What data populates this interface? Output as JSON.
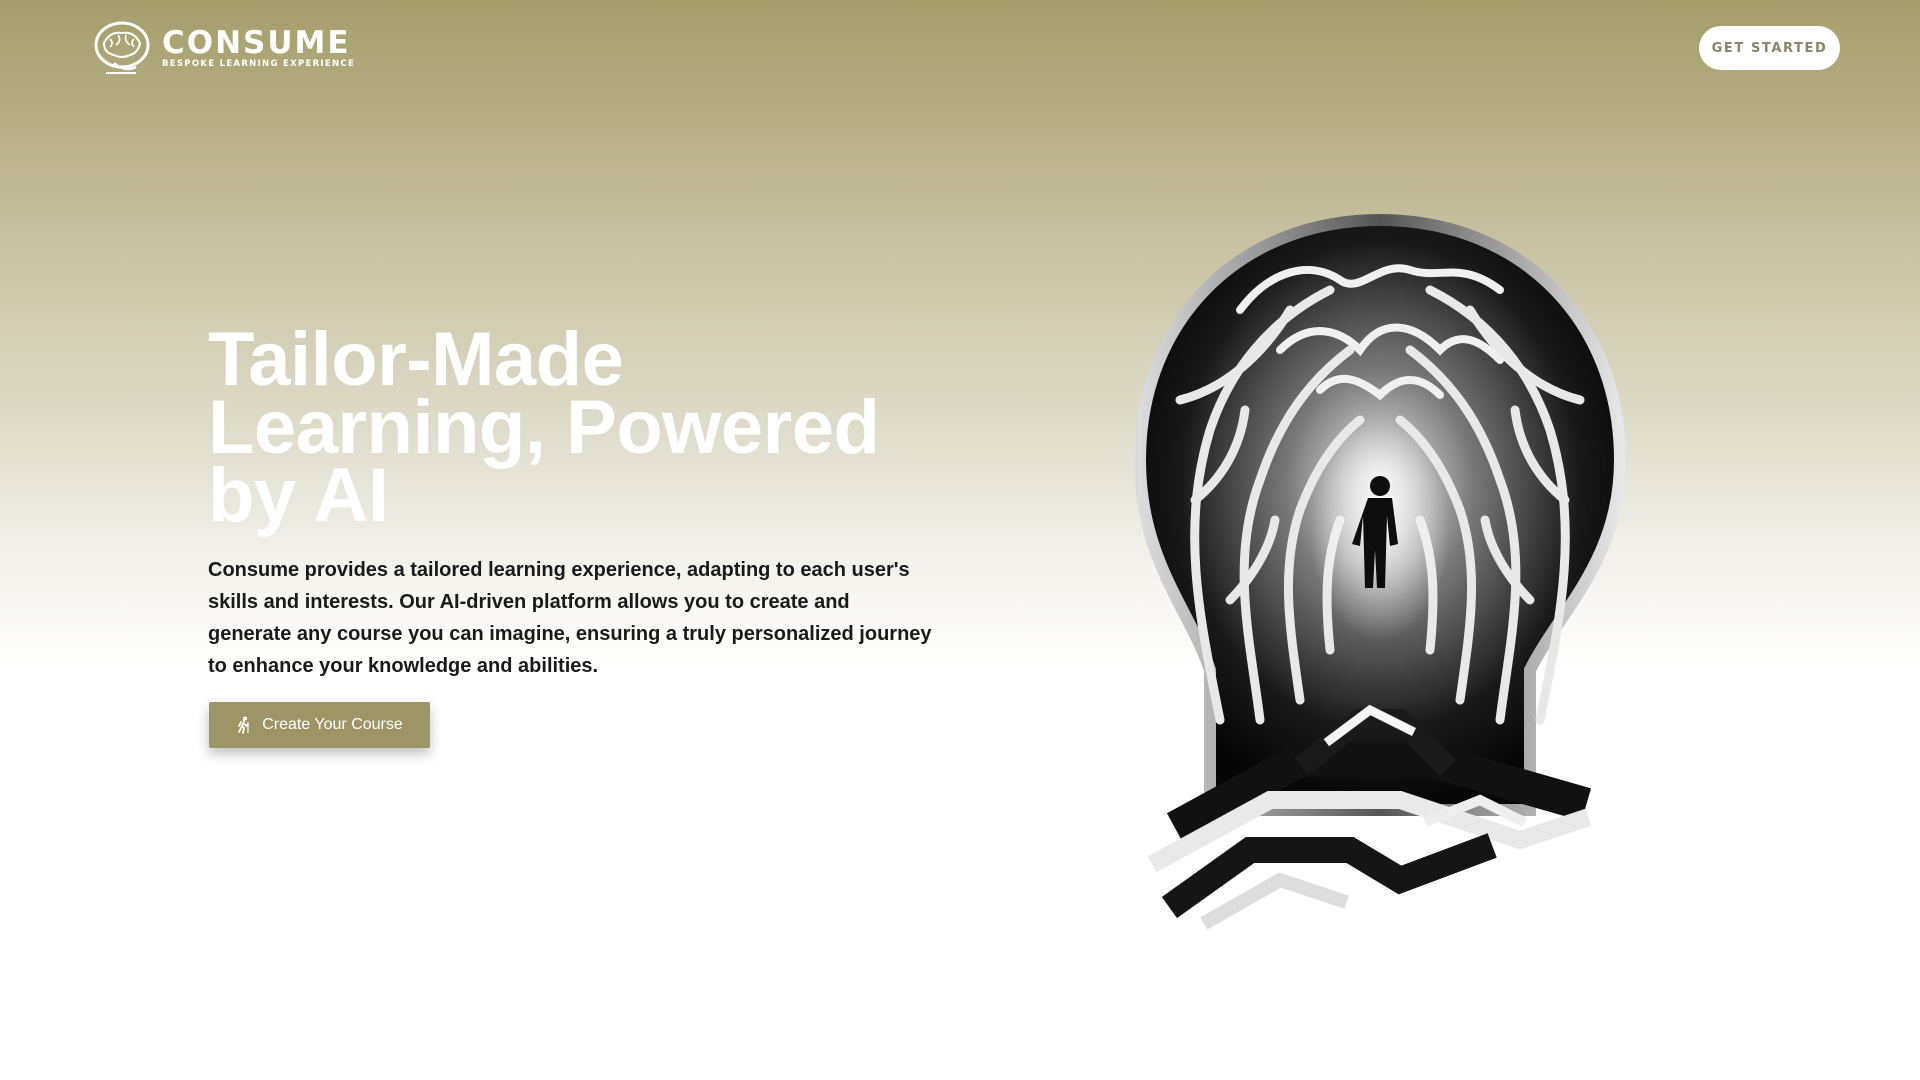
{
  "header": {
    "logo": {
      "name": "CONSUME",
      "tagline": "BESPOKE LEARNING EXPERIENCE",
      "icon": "brain-icon"
    },
    "cta_label": "GET STARTED"
  },
  "hero": {
    "title_lines": [
      "Tailor-Made",
      "Learning, Powered",
      "by AI"
    ],
    "description": "Consume provides a tailored learning experience, adapting to each user's skills and interests. Our AI-driven platform allows you to create and generate any course you can imagine, ensuring a truly personalized journey to enhance your knowledge and abilities.",
    "button_label": "Create Your Course",
    "button_icon": "hiker-icon"
  },
  "illustration": {
    "icon": "brain-maze-illustration"
  },
  "colors": {
    "accent": "#9e9567",
    "header_gradient_top": "#a69e6b",
    "background": "#ffffff",
    "text_dark": "#1a1a1a"
  }
}
